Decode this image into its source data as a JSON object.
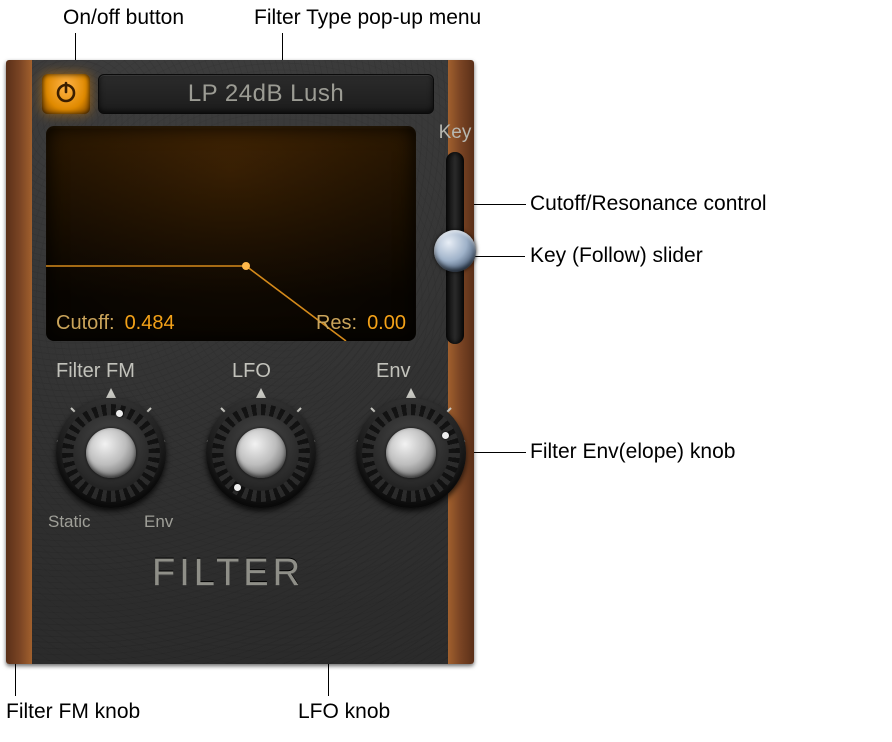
{
  "callouts": {
    "power": "On/off button",
    "ftype": "Filter Type pop-up menu",
    "cutoff_res": "Cutoff/Resonance control",
    "key_slider": "Key (Follow) slider",
    "env_knob": "Filter Env(elope) knob",
    "fm_knob": "Filter FM knob",
    "lfo_knob": "LFO knob"
  },
  "filter_type": "LP 24dB Lush",
  "display": {
    "cutoff_label": "Cutoff:",
    "cutoff_value": "0.484",
    "res_label": "Res:",
    "res_value": "0.00"
  },
  "key_label": "Key",
  "knobs": {
    "fm": {
      "label": "Filter FM",
      "left_text": "Static",
      "right_text": "Env"
    },
    "lfo": {
      "label": "LFO"
    },
    "env": {
      "label": "Env"
    }
  },
  "section": "FILTER"
}
